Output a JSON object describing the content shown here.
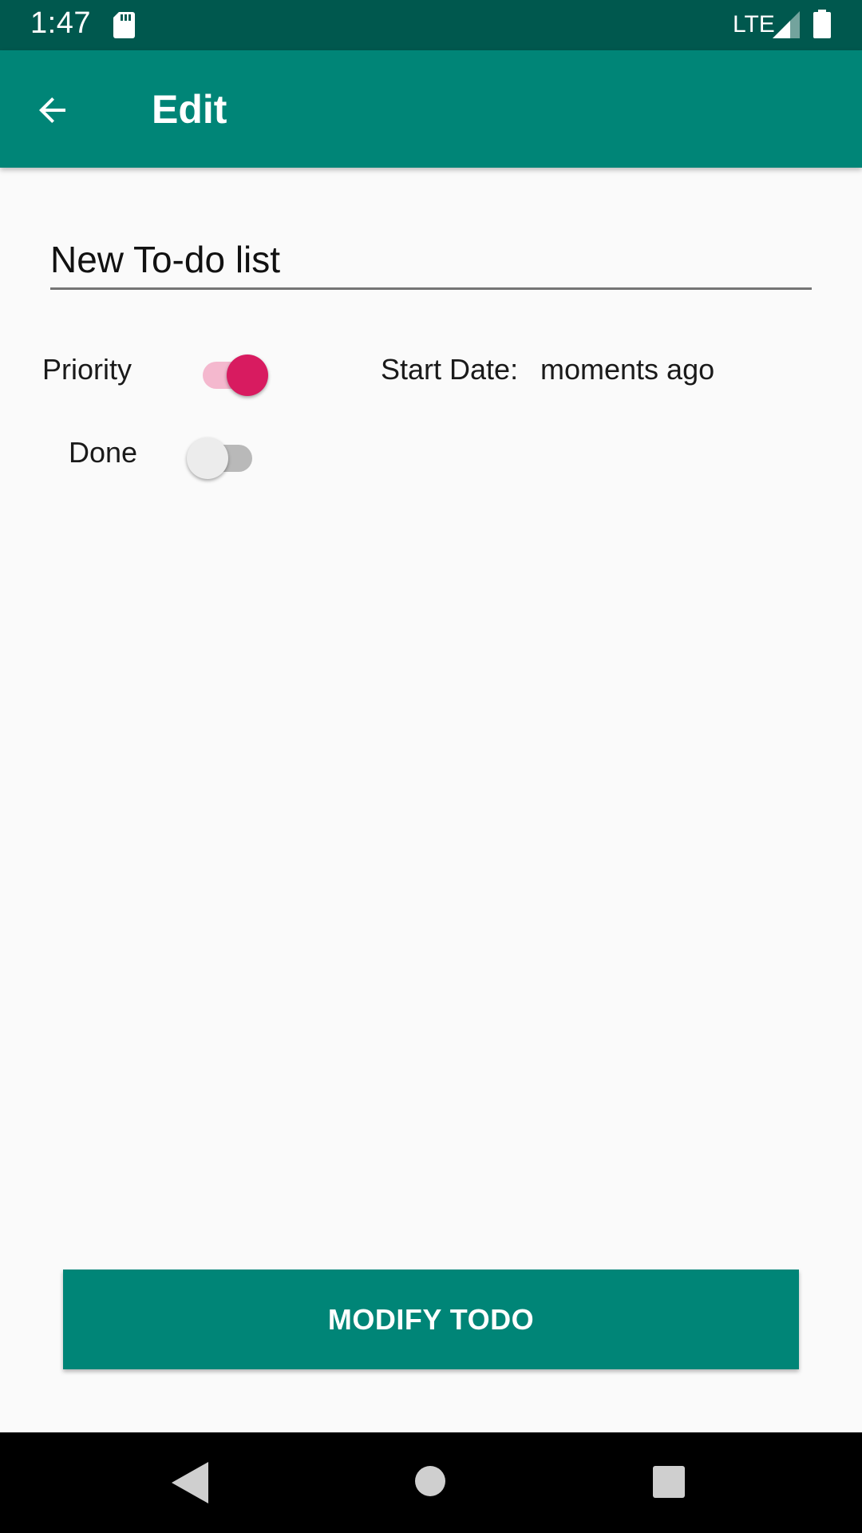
{
  "status_bar": {
    "time": "1:47",
    "network": "LTE",
    "icons": [
      "sd-card-icon",
      "signal-icon",
      "battery-icon"
    ]
  },
  "app_bar": {
    "title": "Edit",
    "back_icon": "arrow-back-icon"
  },
  "form": {
    "title_value": "New To-do list",
    "priority_label": "Priority",
    "priority_on": true,
    "done_label": "Done",
    "done_on": false,
    "start_date_label": "Start Date:",
    "start_date_value": "moments ago"
  },
  "actions": {
    "modify_label": "MODIFY TODO"
  },
  "nav_bar": {
    "icons": [
      "nav-back-icon",
      "nav-home-icon",
      "nav-recents-icon"
    ]
  },
  "colors": {
    "primary": "#008577",
    "primary_dark": "#00584e",
    "accent": "#d81b60",
    "background": "#fafafa"
  }
}
